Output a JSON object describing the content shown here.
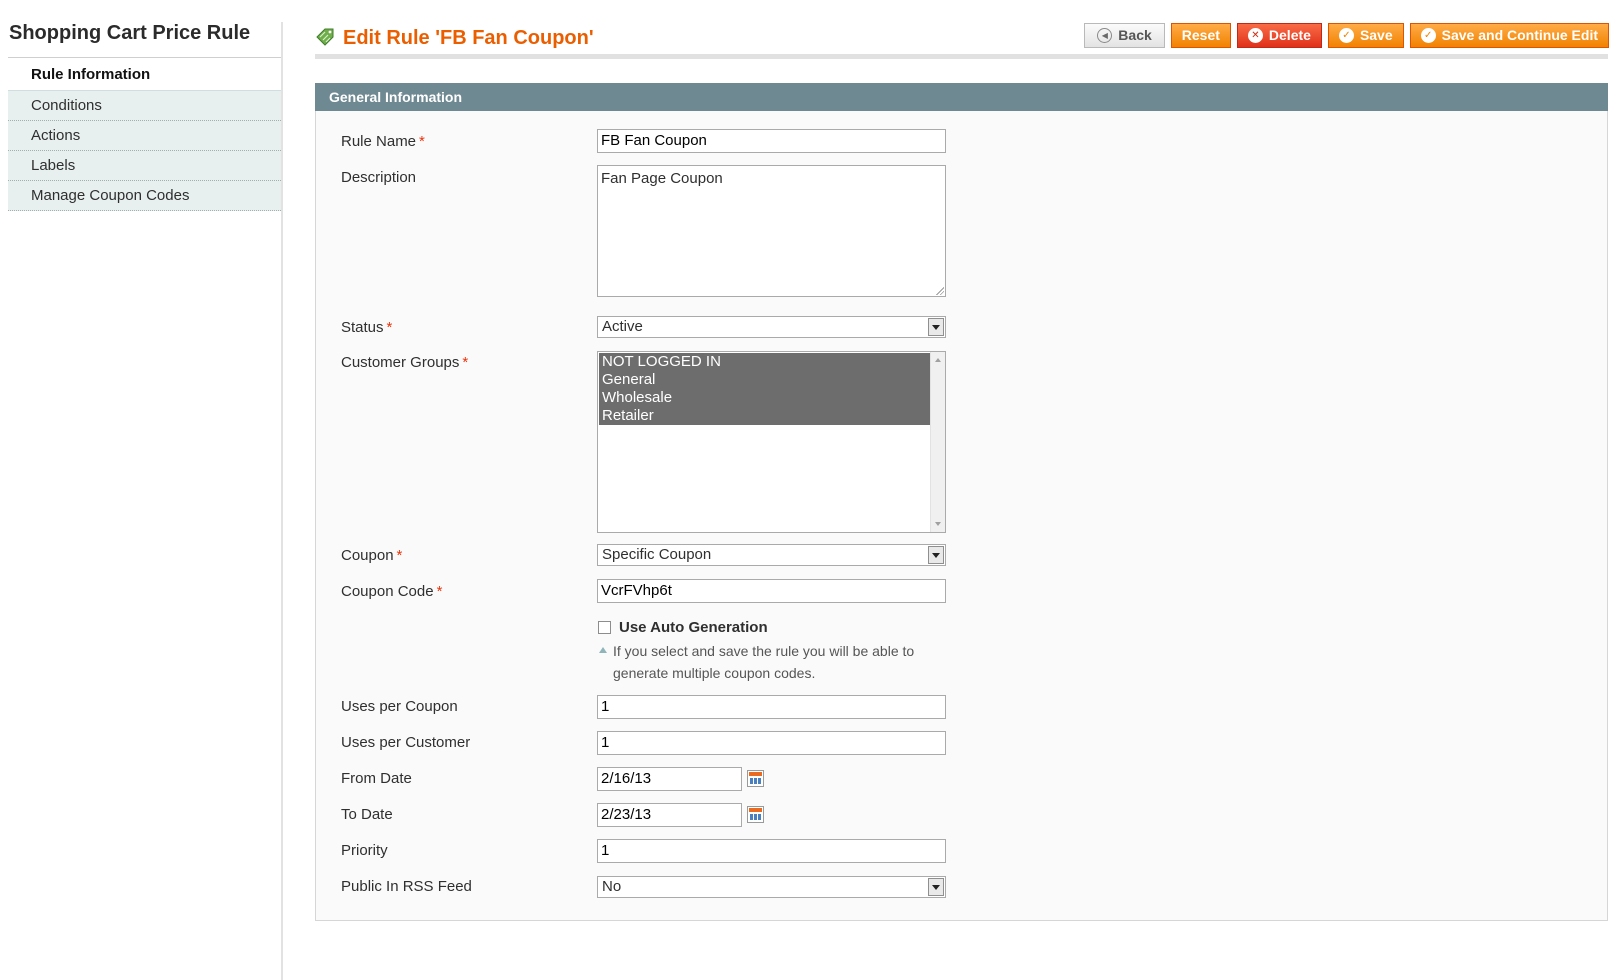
{
  "sidebar": {
    "title": "Shopping Cart Price Rule",
    "tabs": [
      {
        "label": "Rule Information"
      },
      {
        "label": "Conditions"
      },
      {
        "label": "Actions"
      },
      {
        "label": "Labels"
      },
      {
        "label": "Manage Coupon Codes"
      }
    ]
  },
  "header": {
    "title": "Edit Rule 'FB Fan Coupon'",
    "icon": "coupon-tag-icon",
    "buttons": {
      "back": "Back",
      "reset": "Reset",
      "delete": "Delete",
      "save": "Save",
      "save_continue": "Save and Continue Edit"
    }
  },
  "section": {
    "title": "General Information"
  },
  "form": {
    "rule_name": {
      "label": "Rule Name",
      "value": "FB Fan Coupon"
    },
    "description": {
      "label": "Description",
      "value": "Fan Page Coupon"
    },
    "status": {
      "label": "Status",
      "value": "Active"
    },
    "customer_groups": {
      "label": "Customer Groups",
      "options": [
        "NOT LOGGED IN",
        "General",
        "Wholesale",
        "Retailer"
      ]
    },
    "coupon": {
      "label": "Coupon",
      "value": "Specific Coupon"
    },
    "coupon_code": {
      "label": "Coupon Code",
      "value": "VcrFVhp6t"
    },
    "auto_generation": {
      "label": "Use Auto Generation",
      "note": "If you select and save the rule you will be able to generate multiple coupon codes."
    },
    "uses_per_coupon": {
      "label": "Uses per Coupon",
      "value": "1"
    },
    "uses_per_customer": {
      "label": "Uses per Customer",
      "value": "1"
    },
    "from_date": {
      "label": "From Date",
      "value": "2/16/13"
    },
    "to_date": {
      "label": "To Date",
      "value": "2/23/13"
    },
    "priority": {
      "label": "Priority",
      "value": "1"
    },
    "public_rss": {
      "label": "Public In RSS Feed",
      "value": "No"
    }
  },
  "colors": {
    "accent": "#eb5e00",
    "button": "#f18200",
    "delete_button": "#e0301a",
    "section_header": "#6f8992",
    "required": "#eb340a"
  }
}
